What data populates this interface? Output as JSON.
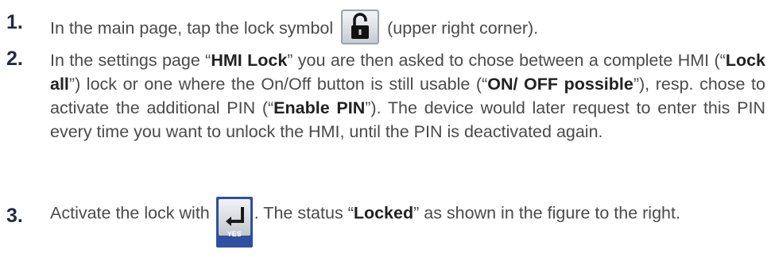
{
  "steps": [
    {
      "num": "1.",
      "pre": "In the main page, tap the lock symbol",
      "icon": "lock-open-icon",
      "post": "(upper right corner)."
    },
    {
      "num": "2.",
      "t1": "In the settings page “",
      "b1": "HMI Lock",
      "t2": "” you are then asked to chose between a complete HMI (“",
      "b2": "Lock all",
      "t3": "”) lock or one where the On/Off button is still usable (“",
      "b3": "ON/ OFF possible",
      "t4": "”), resp. chose to activate the additional PIN (“",
      "b4": "Enable PIN",
      "t5": "”). The device would later request to enter this PIN every time you want to unlock the HMI, until the PIN is deactivated again."
    },
    {
      "num": "3.",
      "pre": "Activate the lock with",
      "icon": "enter-yes-icon",
      "button_label": "YES",
      "mid": ". The status “",
      "bold": "Locked",
      "post": "” as shown in the figure to the right."
    }
  ]
}
